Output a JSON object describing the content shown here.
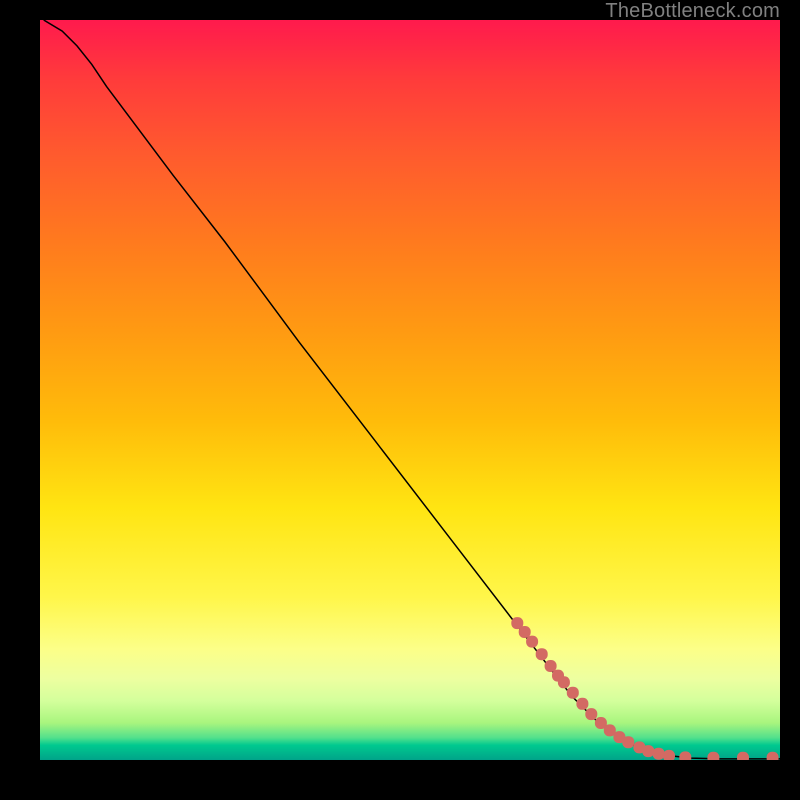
{
  "watermark": "TheBottleneck.com",
  "chart_data": {
    "type": "line",
    "title": "",
    "xlabel": "",
    "ylabel": "",
    "xlim": [
      0,
      100
    ],
    "ylim": [
      0,
      100
    ],
    "curve_xy": [
      [
        0.5,
        100
      ],
      [
        3,
        98.5
      ],
      [
        5,
        96.5
      ],
      [
        7,
        94
      ],
      [
        9,
        91
      ],
      [
        12,
        87
      ],
      [
        18,
        79
      ],
      [
        25,
        70
      ],
      [
        35,
        56.5
      ],
      [
        45,
        43.5
      ],
      [
        55,
        30.5
      ],
      [
        65,
        17.5
      ],
      [
        70,
        11
      ],
      [
        72,
        8.5
      ],
      [
        75,
        5.5
      ],
      [
        78,
        3.2
      ],
      [
        81,
        1.6
      ],
      [
        84,
        0.7
      ],
      [
        88,
        0.25
      ],
      [
        92,
        0.15
      ],
      [
        96,
        0.15
      ],
      [
        100,
        0.15
      ]
    ],
    "scatter_xy": [
      [
        64.5,
        18.5
      ],
      [
        65.5,
        17.3
      ],
      [
        66.5,
        16.0
      ],
      [
        67.8,
        14.3
      ],
      [
        69.0,
        12.7
      ],
      [
        70.0,
        11.4
      ],
      [
        70.8,
        10.5
      ],
      [
        72.0,
        9.1
      ],
      [
        73.3,
        7.6
      ],
      [
        74.5,
        6.2
      ],
      [
        75.8,
        5.0
      ],
      [
        77.0,
        4.0
      ],
      [
        78.3,
        3.1
      ],
      [
        79.5,
        2.4
      ],
      [
        81.0,
        1.7
      ],
      [
        82.2,
        1.2
      ],
      [
        83.6,
        0.85
      ],
      [
        85.0,
        0.55
      ],
      [
        87.2,
        0.35
      ],
      [
        91.0,
        0.3
      ],
      [
        95.0,
        0.3
      ],
      [
        99.0,
        0.3
      ]
    ],
    "dot_color": "#d36a63"
  }
}
